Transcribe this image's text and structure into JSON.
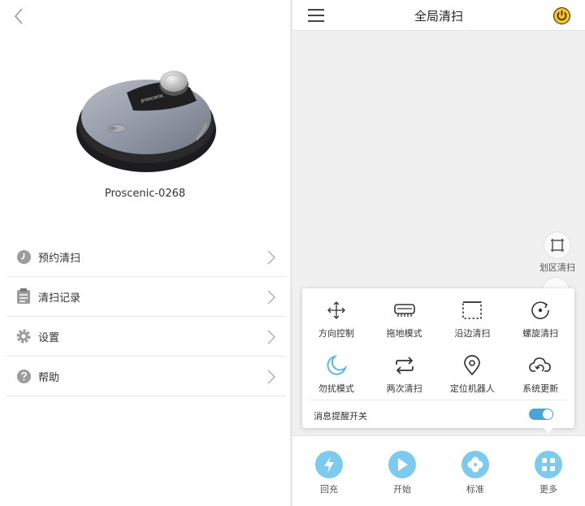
{
  "left_panel": {
    "device_name": "Proscenic-0268",
    "robot_brand_text": "proscenic",
    "menu": [
      {
        "label": "预约清扫",
        "icon": "clock-icon"
      },
      {
        "label": "清扫记录",
        "icon": "record-icon"
      },
      {
        "label": "设置",
        "icon": "gear-icon"
      },
      {
        "label": "帮助",
        "icon": "help-icon"
      }
    ]
  },
  "right_panel": {
    "title": "全局清扫",
    "zone_clean_label": "划区清扫",
    "more_popup": {
      "items": [
        {
          "label": "方向控制",
          "icon": "direction-control-icon"
        },
        {
          "label": "拖地模式",
          "icon": "mop-mode-icon"
        },
        {
          "label": "沿边清扫",
          "icon": "edge-clean-icon"
        },
        {
          "label": "螺旋清扫",
          "icon": "spiral-clean-icon"
        },
        {
          "label": "勿扰模式",
          "icon": "do-not-disturb-icon"
        },
        {
          "label": "两次清扫",
          "icon": "repeat-clean-icon"
        },
        {
          "label": "定位机器人",
          "icon": "locate-robot-icon"
        },
        {
          "label": "系统更新",
          "icon": "cloud-update-icon"
        }
      ],
      "notify_label": "消息提醒开关",
      "notify_on": true
    },
    "bottom_bar": [
      {
        "label": "回充",
        "icon": "charge-icon"
      },
      {
        "label": "开始",
        "icon": "play-icon"
      },
      {
        "label": "标准",
        "icon": "fan-icon"
      },
      {
        "label": "更多",
        "icon": "more-icon"
      }
    ]
  },
  "colors": {
    "accent": "#7ccbee",
    "toggle_on": "#4aa4d6",
    "moon": "#58b7e4",
    "power_badge": "#f5c518"
  }
}
